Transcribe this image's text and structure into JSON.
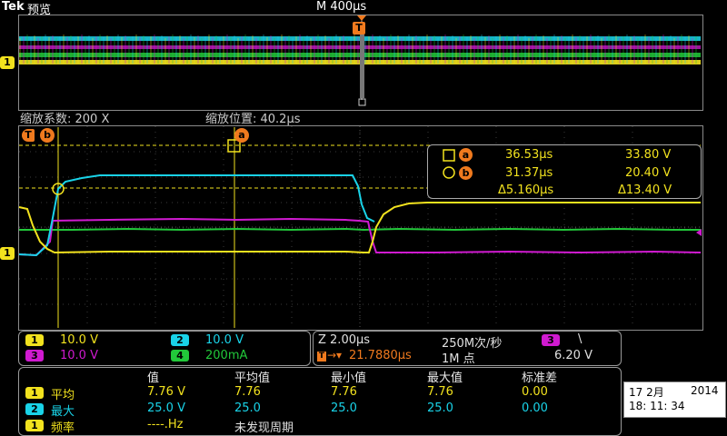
{
  "header": {
    "brand": "Tek",
    "mode": "预览",
    "timebase": "M 400µs"
  },
  "zoom": {
    "factor_label": "缩放系数: 200 X",
    "position_label": "缩放位置: 40.2µs"
  },
  "markers": {
    "trigger": "T",
    "cursor_a": "a",
    "cursor_b": "b",
    "channel1": "1"
  },
  "cursor_readout": {
    "a_time": "36.53µs",
    "a_volt": "33.80 V",
    "b_time": "31.37µs",
    "b_volt": "20.40 V",
    "delta_time": "Δ5.160µs",
    "delta_volt": "Δ13.40 V"
  },
  "channels": {
    "ch1": {
      "num": "1",
      "scale": "10.0 V",
      "color": "#f2e21e"
    },
    "ch2": {
      "num": "2",
      "scale": "10.0 V",
      "color": "#19d3e8"
    },
    "ch3": {
      "num": "3",
      "scale": "10.0 V",
      "color": "#d01ad0"
    },
    "ch4": {
      "num": "4",
      "scale": "200mA",
      "color": "#22c83a"
    }
  },
  "acquisition": {
    "zoom_timebase": "Z 2.00µs",
    "sample_rate": "250M次/秒",
    "trigger_pos": "21.7880µs",
    "record_length": "1M 点",
    "trig_source": "3",
    "trig_slope": "\\",
    "trig_level": "6.20 V"
  },
  "measurements": {
    "headers": [
      "值",
      "平均值",
      "最小值",
      "最大值",
      "标准差"
    ],
    "rows": [
      {
        "ch": "1",
        "color": "#f2e21e",
        "name": "平均",
        "values": [
          "7.76 V",
          "7.76",
          "7.76",
          "7.76",
          "0.00"
        ]
      },
      {
        "ch": "2",
        "color": "#19d3e8",
        "name": "最大",
        "values": [
          "25.0 V",
          "25.0",
          "25.0",
          "25.0",
          "0.00"
        ]
      },
      {
        "ch": "1",
        "color": "#f2e21e",
        "name": "频率",
        "values": [
          "----.Hz",
          "未发现周期"
        ]
      }
    ]
  },
  "datetime": {
    "date": "17 2月",
    "year": "2014",
    "time": "18: 11: 34"
  }
}
